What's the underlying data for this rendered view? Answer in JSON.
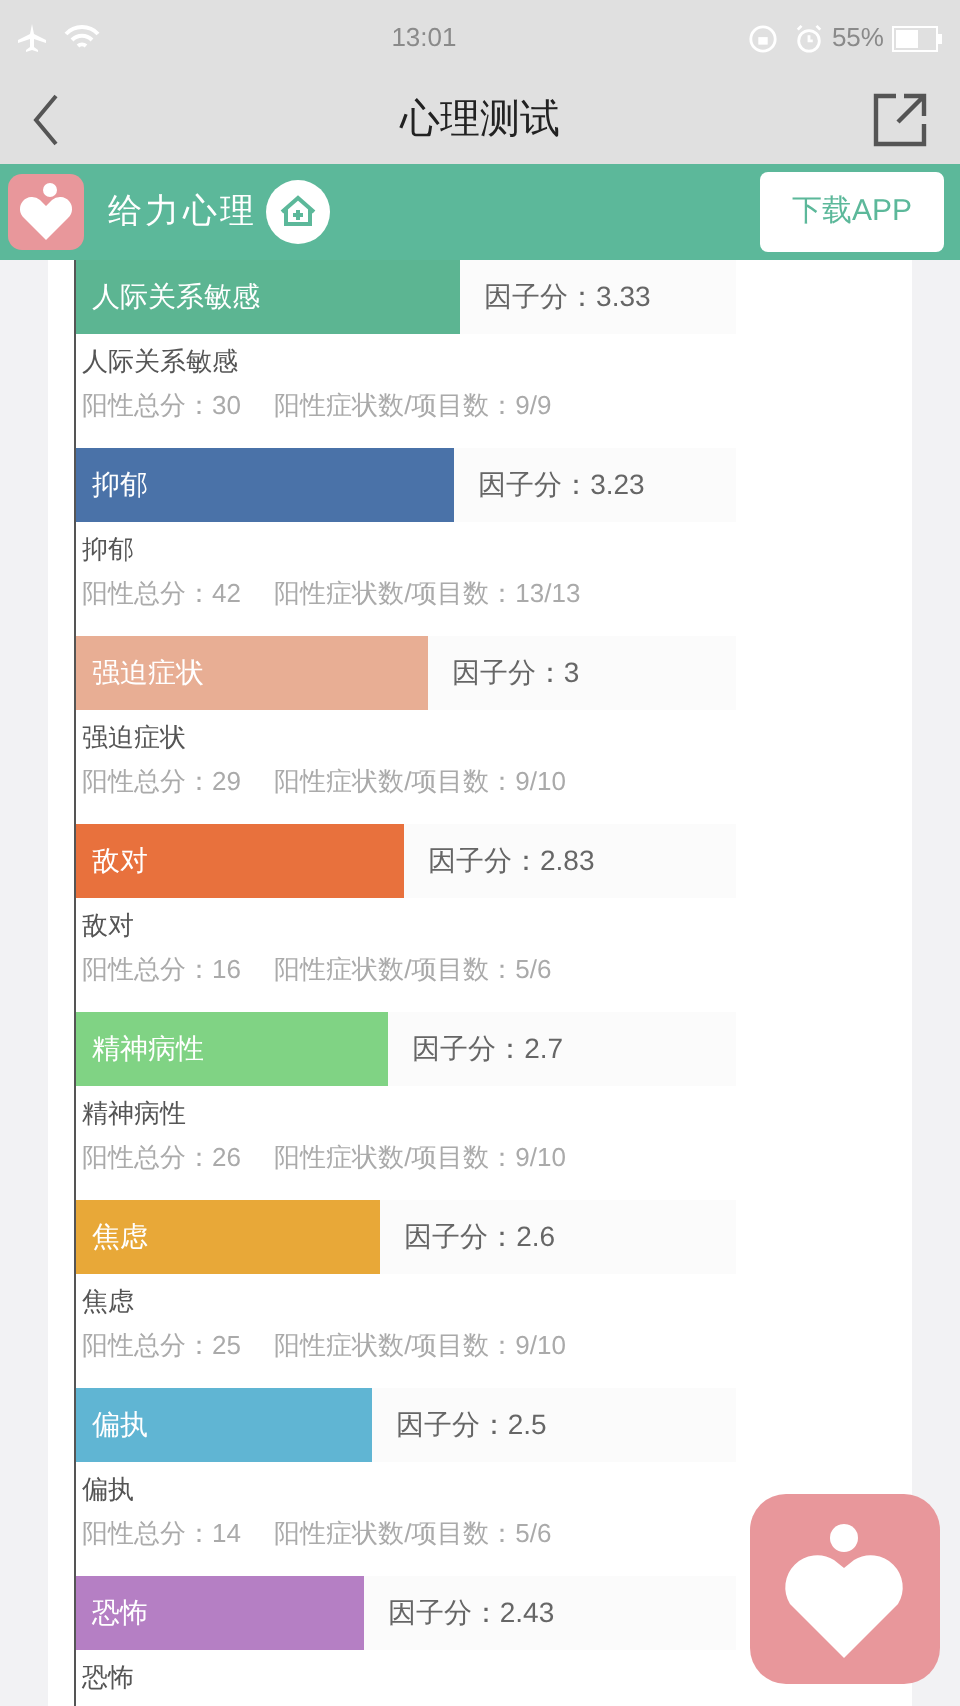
{
  "status_bar": {
    "time": "13:01",
    "battery": "55%"
  },
  "nav": {
    "title": "心理测试"
  },
  "banner": {
    "brand": "给力心理",
    "download_button": "下载APP"
  },
  "factors": [
    {
      "bar_label": "人际关系敏感",
      "score": "因子分：3.33",
      "level": 0.582,
      "color": "#5cb592",
      "name": "人际关系敏感",
      "stats": "阳性总分：30　 阳性症状数/项目数：9/9"
    },
    {
      "bar_label": "抑郁",
      "score": "因子分：3.23",
      "level": 0.573,
      "color": "#4a72a8",
      "name": "抑郁",
      "stats": "阳性总分：42　 阳性症状数/项目数：13/13"
    },
    {
      "bar_label": "强迫症状",
      "score": "因子分：3",
      "level": 0.533,
      "color": "#e8ae94",
      "name": "强迫症状",
      "stats": "阳性总分：29　 阳性症状数/项目数：9/10"
    },
    {
      "bar_label": "敌对",
      "score": "因子分：2.83",
      "level": 0.497,
      "color": "#e8713d",
      "name": "敌对",
      "stats": "阳性总分：16　 阳性症状数/项目数：5/6"
    },
    {
      "bar_label": "精神病性",
      "score": "因子分：2.7",
      "level": 0.473,
      "color": "#80d384",
      "name": "精神病性",
      "stats": "阳性总分：26　 阳性症状数/项目数：9/10"
    },
    {
      "bar_label": "焦虑",
      "score": "因子分：2.6",
      "level": 0.461,
      "color": "#e8a838",
      "name": "焦虑",
      "stats": "阳性总分：25　 阳性症状数/项目数：9/10"
    },
    {
      "bar_label": "偏执",
      "score": "因子分：2.5",
      "level": 0.448,
      "color": "#60b5d3",
      "name": "偏执",
      "stats": "阳性总分：14　 阳性症状数/项目数：5/6"
    },
    {
      "bar_label": "恐怖",
      "score": "因子分：2.43",
      "level": 0.436,
      "color": "#b57fc4",
      "name": "恐怖"
    }
  ]
}
